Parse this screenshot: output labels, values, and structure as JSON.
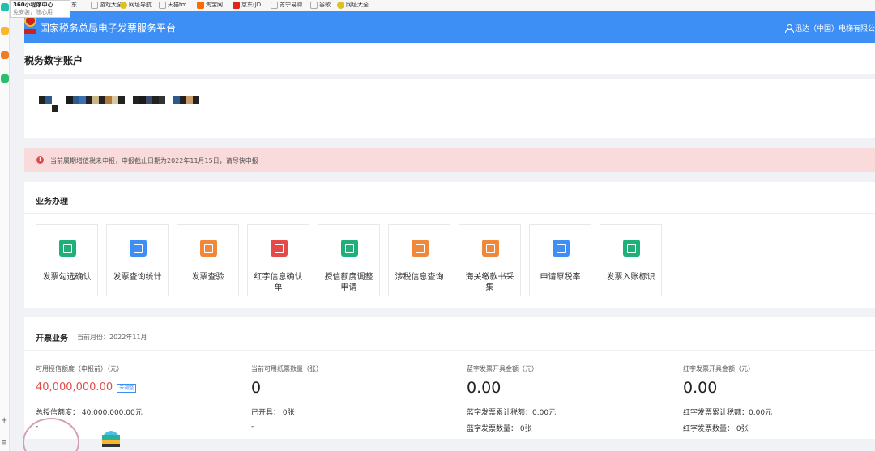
{
  "browser": {
    "tooltip_title": "360小程序中心",
    "tooltip_sub": "免安装，随心用",
    "bookmarks": [
      {
        "label": "东",
        "color": "#e8e8e8"
      },
      {
        "label": "游戏大全",
        "color": "#e8e8e8"
      },
      {
        "label": "网址导航",
        "color": "#e0c020"
      },
      {
        "label": "天猫tm",
        "color": "#e8e8e8"
      },
      {
        "label": "淘宝网",
        "color": "#ff6a00"
      },
      {
        "label": "京东(JD",
        "color": "#e1251b"
      },
      {
        "label": "苏宁易购",
        "color": "#e8e8e8"
      },
      {
        "label": "谷歌",
        "color": "#e8e8e8"
      },
      {
        "label": "网址大全",
        "color": "#e0c020"
      }
    ]
  },
  "header": {
    "title": "国家税务总局电子发票服务平台",
    "user": "迅达（中国）电梯有限公"
  },
  "page": {
    "title": "税务数字账户"
  },
  "alert": {
    "message": "当前属期增值税未申报，申报截止日期为2022年11月15日，请尽快申报"
  },
  "business": {
    "title": "业务办理",
    "tiles": [
      {
        "label": "发票勾选确认",
        "color": "#1fb07a",
        "icon": "ticket-icon"
      },
      {
        "label": "发票查询统计",
        "color": "#3e8ff5",
        "icon": "search-doc-icon"
      },
      {
        "label": "发票查验",
        "color": "#f0883a",
        "icon": "ticket-check-icon"
      },
      {
        "label": "红字信息确认单",
        "color": "#e34b4b",
        "icon": "red-doc-icon"
      },
      {
        "label": "授信额度调整申请",
        "color": "#1fb07a",
        "icon": "edit-doc-icon"
      },
      {
        "label": "涉税信息查询",
        "color": "#f0883a",
        "icon": "folder-search-icon"
      },
      {
        "label": "海关缴款书采集",
        "color": "#f0883a",
        "icon": "customs-icon"
      },
      {
        "label": "申请原税率",
        "color": "#3e8ff5",
        "icon": "apply-icon"
      },
      {
        "label": "发票入账标识",
        "color": "#1fb07a",
        "icon": "ledger-icon"
      }
    ]
  },
  "invoicing": {
    "title": "开票业务",
    "month": "当前月份：2022年11月",
    "stats": [
      {
        "label": "可用授信额度（申报前）（元）",
        "value": "40,000,000.00",
        "tag": "去调整",
        "sub1": "总授信额度：  40,000,000.00元",
        "sub2": "-"
      },
      {
        "label": "当前可用纸票数量（张）",
        "value": "0",
        "sub1": "已开具：  0张",
        "sub2": "-"
      },
      {
        "label": "蓝字发票开具金额（元）",
        "value": "0.00",
        "sub1": "蓝字发票累计税额：0.00元",
        "sub2": "蓝字发票数量：  0张"
      },
      {
        "label": "红字发票开具金额（元）",
        "value": "0.00",
        "sub1": "红字发票累计税额：0.00元",
        "sub2": "红字发票数量：  0张"
      }
    ]
  },
  "colors": {
    "header": "#3e8ff5",
    "alert_bg": "#fadbdb",
    "alert_icon": "#e34b4b",
    "credit_value": "#e34b4b"
  }
}
